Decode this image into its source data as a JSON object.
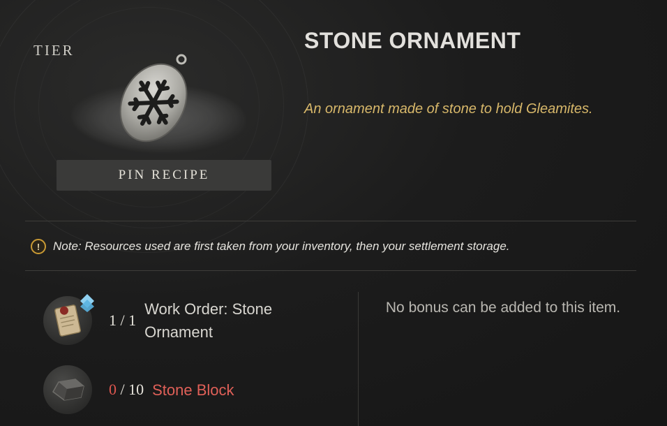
{
  "item": {
    "tier_label": "TIER",
    "title": "STONE ORNAMENT",
    "description": "An ornament made of stone to hold Gleamites.",
    "pin_recipe_label": "PIN RECIPE"
  },
  "note": {
    "icon": "exclamation-icon",
    "text": "Note: Resources used are first taken from your inventory, then your settlement storage."
  },
  "resources": [
    {
      "icon": "scroll-icon",
      "have": "1",
      "separator": " / ",
      "need": "1",
      "name": "Work Order: Stone Ornament",
      "name_color": "#d9d7d1"
    },
    {
      "icon": "stone-block-icon",
      "have": "0",
      "separator": " / ",
      "need": "10",
      "name": "Stone Block",
      "name_color": "#e06058"
    }
  ],
  "bonus": {
    "text": "No bonus can be added to this item."
  },
  "colors": {
    "accent_gold": "#d8b86a",
    "missing_red": "#e06058",
    "note_icon_border": "#c99a34"
  }
}
